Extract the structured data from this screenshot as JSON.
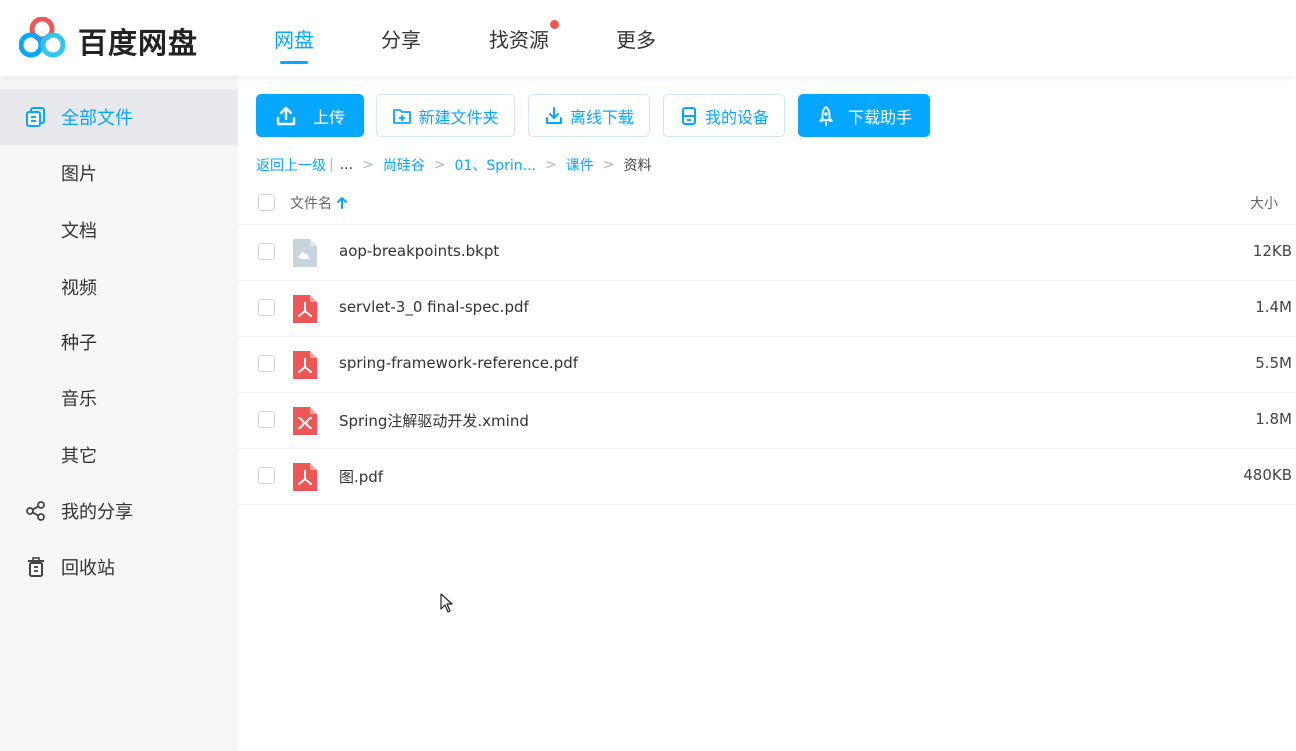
{
  "app": {
    "brand": "百度网盘",
    "accent": "#06a7ff"
  },
  "topnav": {
    "tabs": [
      {
        "label": "网盘",
        "active": true
      },
      {
        "label": "分享",
        "active": false
      },
      {
        "label": "找资源",
        "active": false,
        "badge": "red-dot"
      },
      {
        "label": "更多",
        "active": false
      }
    ]
  },
  "sidebar": {
    "items": [
      {
        "label": "全部文件",
        "icon": "all-files-icon",
        "active": true
      },
      {
        "label": "图片"
      },
      {
        "label": "文档"
      },
      {
        "label": "视频"
      },
      {
        "label": "种子"
      },
      {
        "label": "音乐"
      },
      {
        "label": "其它"
      },
      {
        "label": "我的分享",
        "icon": "share-icon"
      },
      {
        "label": "回收站",
        "icon": "trash-icon"
      }
    ]
  },
  "toolbar": {
    "upload": "上传",
    "new_folder": "新建文件夹",
    "offline_download": "离线下载",
    "my_devices": "我的设备",
    "download_helper": "下载助手"
  },
  "breadcrumb": {
    "back": "返回上一级",
    "ellipsis": "...",
    "crumbs": [
      "尚硅谷",
      "01、Sprin...",
      "课件"
    ],
    "current": "资料"
  },
  "table": {
    "col_name": "文件名",
    "col_size": "大小",
    "rows": [
      {
        "name": "aop-breakpoints.bkpt",
        "size": "12KB",
        "type": "generic-file-icon"
      },
      {
        "name": "servlet-3_0 final-spec.pdf",
        "size": "1.4M",
        "type": "pdf-icon"
      },
      {
        "name": "spring-framework-reference.pdf",
        "size": "5.5M",
        "type": "pdf-icon"
      },
      {
        "name": "Spring注解驱动开发.xmind",
        "size": "1.8M",
        "type": "xmind-icon"
      },
      {
        "name": "图.pdf",
        "size": "480KB",
        "type": "pdf-icon"
      }
    ]
  }
}
